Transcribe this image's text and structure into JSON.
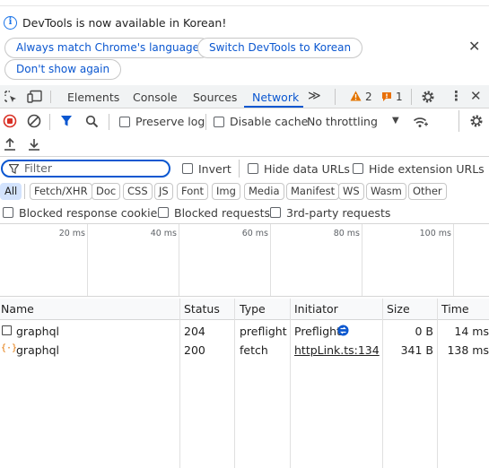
{
  "infobar": {
    "message": "DevTools is now available in Korean!",
    "buttons": [
      "Always match Chrome's language",
      "Switch DevTools to Korean",
      "Don't show again"
    ],
    "close": "✕"
  },
  "tabs": {
    "items": [
      "Elements",
      "Console",
      "Sources",
      "Network"
    ],
    "active": "Network",
    "more": "≫",
    "warnings": "2",
    "issues": "1"
  },
  "toolbar": {
    "preserve_log": "Preserve log",
    "disable_cache": "Disable cache",
    "throttling": "No throttling"
  },
  "filter": {
    "placeholder": "Filter",
    "invert": "Invert",
    "hide_data_urls": "Hide data URLs",
    "hide_extension_urls": "Hide extension URLs"
  },
  "type_filters": [
    "All",
    "Fetch/XHR",
    "Doc",
    "CSS",
    "JS",
    "Font",
    "Img",
    "Media",
    "Manifest",
    "WS",
    "Wasm",
    "Other"
  ],
  "checkboxes": {
    "blocked_cookies": "Blocked response cookies",
    "blocked_requests": "Blocked requests",
    "third_party": "3rd-party requests"
  },
  "overview": {
    "ticks": [
      "20 ms",
      "40 ms",
      "60 ms",
      "80 ms",
      "100 ms"
    ]
  },
  "table": {
    "columns": [
      "Name",
      "Status",
      "Type",
      "Initiator",
      "Size",
      "Time"
    ],
    "rows": [
      {
        "name": "graphql",
        "status": "204",
        "type": "preflight",
        "initiator": "Preflight",
        "size": "0 B",
        "time": "14 ms"
      },
      {
        "name": "graphql",
        "status": "200",
        "type": "fetch",
        "initiator": "httpLink.ts:134",
        "size": "341 B",
        "time": "138 ms"
      }
    ]
  },
  "colors": {
    "accent": "#0b57d0",
    "record": "#d93025",
    "warning": "#e37400",
    "issue": "#e8710a"
  }
}
